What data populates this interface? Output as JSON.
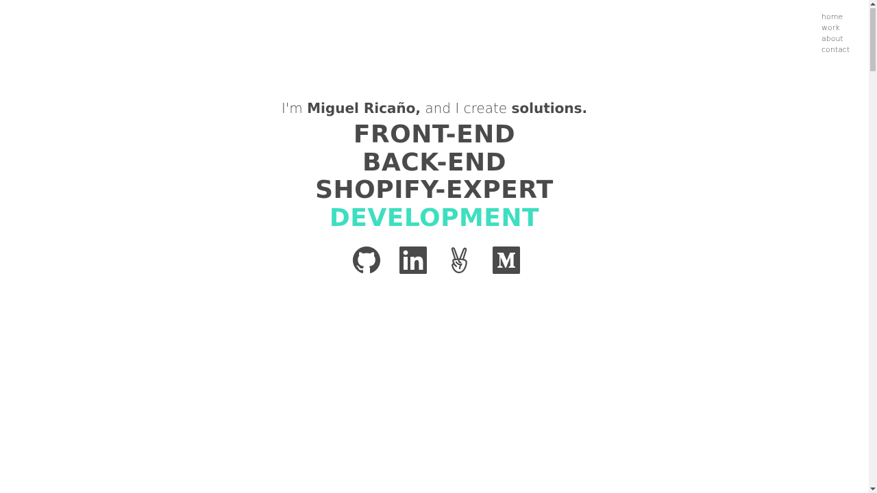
{
  "nav": {
    "items": [
      {
        "label": "home"
      },
      {
        "label": "work"
      },
      {
        "label": "about"
      },
      {
        "label": "contact"
      }
    ]
  },
  "hero": {
    "intro_prefix": "I'm ",
    "name": "Miguel Ricaño,",
    "intro_middle": " and I create ",
    "highlight": "solutions.",
    "roles": [
      "FRONT-END",
      "BACK-END",
      "SHOPIFY-EXPERT"
    ],
    "accent_role": "DEVELOPMENT"
  },
  "socials": [
    {
      "icon": "github-icon"
    },
    {
      "icon": "linkedin-icon"
    },
    {
      "icon": "angellist-icon"
    },
    {
      "icon": "medium-icon"
    }
  ],
  "colors": {
    "text": "#4a4a4a",
    "accent": "#3ddfc0",
    "background": "#ffffff"
  }
}
